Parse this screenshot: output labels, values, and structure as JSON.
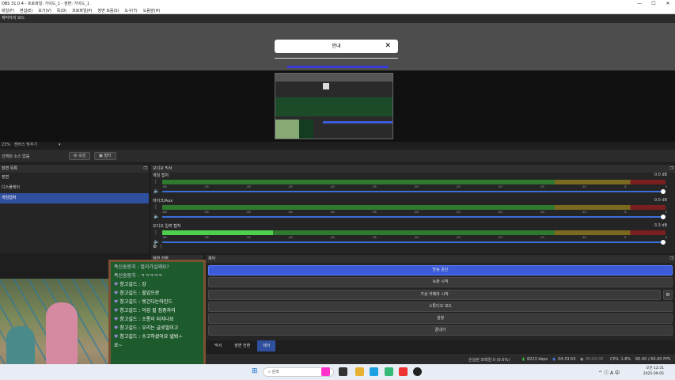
{
  "window": {
    "title": "OBS 31.0.4 - 프로파일: 가이드_1 - 장면: 가이드_1",
    "minimize": "—",
    "maximize": "☐",
    "close": "✕"
  },
  "menu": [
    "파일(F)",
    "편집(E)",
    "보기(V)",
    "독(D)",
    "프로파일(P)",
    "장면 모음(S)",
    "도구(T)",
    "도움말(H)"
  ],
  "preview": {
    "label": "제작자의 모드",
    "dialog_title": "안내",
    "dialog_close": "✕"
  },
  "zoom": {
    "value": "23%",
    "label": "캔버스 맞추기"
  },
  "source_bar": {
    "label": "선택된 소스 없음",
    "props": "⚙ 속성",
    "filters": "▣ 필터"
  },
  "scenes": {
    "header": "장면 목록",
    "items": [
      "장면",
      "디스플레이",
      "게임캡처"
    ],
    "selected": 2
  },
  "mixer": {
    "header": "오디오 믹서",
    "channels": [
      {
        "name": "게임 캡처",
        "db": "0.0 dB",
        "level": 0.0
      },
      {
        "name": "마이크/Aux",
        "db": "0.0 dB",
        "level": 0.0
      },
      {
        "name": "오디오 입력 캡처",
        "db": "-3.3 dB",
        "level": 0.22
      }
    ],
    "ticks": [
      "-60",
      "-55",
      "-50",
      "-45",
      "-40",
      "-35",
      "-30",
      "-25",
      "-20",
      "-15",
      "-10",
      "-5",
      "0"
    ]
  },
  "scene_controls_label": "장면 전환",
  "controls": {
    "header": "제어",
    "buttons": [
      "방송 중단",
      "녹화 시작",
      "가상 카메라 시작",
      "스튜디오 모드",
      "설정",
      "끝내기"
    ],
    "tabs": [
      "믹서",
      "장면 전환",
      "제어"
    ],
    "active_tab": 2
  },
  "status": {
    "dropped": "손실된 프레임 0 (0.0%)",
    "bitrate": "8223 kbps",
    "live": "04:33:53",
    "rec": "00:00:00",
    "cpu": "CPU: 1.8%",
    "fps": "60.00 / 60.00 FPS"
  },
  "chat": [
    {
      "text": "폭신솜뭉치 : 멀리가실께요?",
      "dim": true
    },
    {
      "text": "폭신솜뭉치 : ㅋㅋㅋㅋㅋ",
      "dim": true
    },
    {
      "text": "창고길드 : 강",
      "dim": false
    },
    {
      "text": "창고길드 : 힐업으로",
      "dim": false
    },
    {
      "text": "창고길드 : 벗긴다는마인드",
      "dim": false
    },
    {
      "text": "창고길드 : 이감 될 집중자이",
      "dim": false
    },
    {
      "text": "창고길드 : 소통이 되자나요",
      "dim": false
    },
    {
      "text": "창고길드 : 우리는 글로벌이고",
      "dim": false
    },
    {
      "text": "창고길드 : 수고하셨어요 낼뵈ㅗ",
      "dim": false
    },
    {
      "text": "요~",
      "dim": false
    }
  ],
  "taskbar": {
    "search": "검색",
    "tray": "^ ⓘ A 中",
    "time": "오전 12:31",
    "date": "2025-09-05"
  },
  "colors": {
    "accent": "#3b5bd9",
    "chat_bg": "#1e5b2c",
    "chat_border": "#7b5133"
  }
}
